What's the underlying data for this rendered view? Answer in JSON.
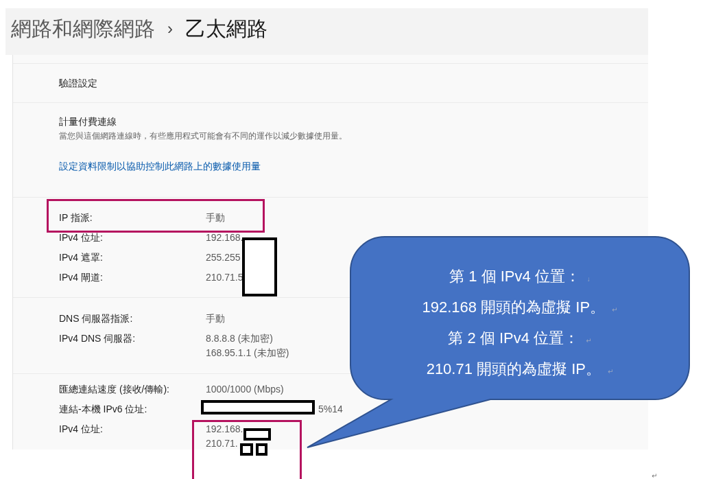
{
  "breadcrumb": {
    "parent": "網路和網際網路",
    "separator": "›",
    "current": "乙太網路"
  },
  "sections": [
    {
      "kind": "link-row",
      "title": "驗證設定"
    },
    {
      "kind": "metered",
      "title": "計量付費連線",
      "description": "當您與這個網路連線時，有些應用程式可能會有不同的運作以減少數據使用量。",
      "link": "設定資料限制以協助控制此網路上的數據使用量"
    },
    {
      "kind": "properties",
      "rows": [
        {
          "label": "IP 指派:",
          "values": [
            "手動"
          ]
        },
        {
          "label": "IPv4 位址:",
          "values": [
            "192.168."
          ]
        },
        {
          "label": "IPv4 遮罩:",
          "values": [
            "255.255"
          ]
        },
        {
          "label": "IPv4 閘道:",
          "values": [
            "210.71.5"
          ]
        }
      ]
    },
    {
      "kind": "properties",
      "rows": [
        {
          "label": "DNS 伺服器指派:",
          "values": [
            "手動"
          ]
        },
        {
          "label": "IPv4 DNS 伺服器:",
          "values": [
            "8.8.8.8 (未加密)",
            "168.95.1.1 (未加密)"
          ]
        }
      ]
    },
    {
      "kind": "properties",
      "rows": [
        {
          "label": "匯總連結速度 (接收/傳輸):",
          "values": [
            "1000/1000 (Mbps)"
          ]
        },
        {
          "label": "連結-本機 IPv6 位址:",
          "values": [
            "5%14"
          ]
        },
        {
          "label": "IPv4 位址:",
          "values": [
            "192.168.",
            "210.71."
          ]
        }
      ]
    }
  ],
  "callout": {
    "lines": [
      {
        "text": "第 1 個 IPv4 位置：",
        "mark": "↓"
      },
      {
        "text": "192.168 開頭的為虛擬 IP。",
        "mark": "↵"
      },
      {
        "text": "第 2 個 IPv4 位置：",
        "mark": "↵"
      },
      {
        "text": "210.71 開頭的為虛擬 IP。",
        "mark": "↵"
      }
    ]
  },
  "end_mark": "↵"
}
